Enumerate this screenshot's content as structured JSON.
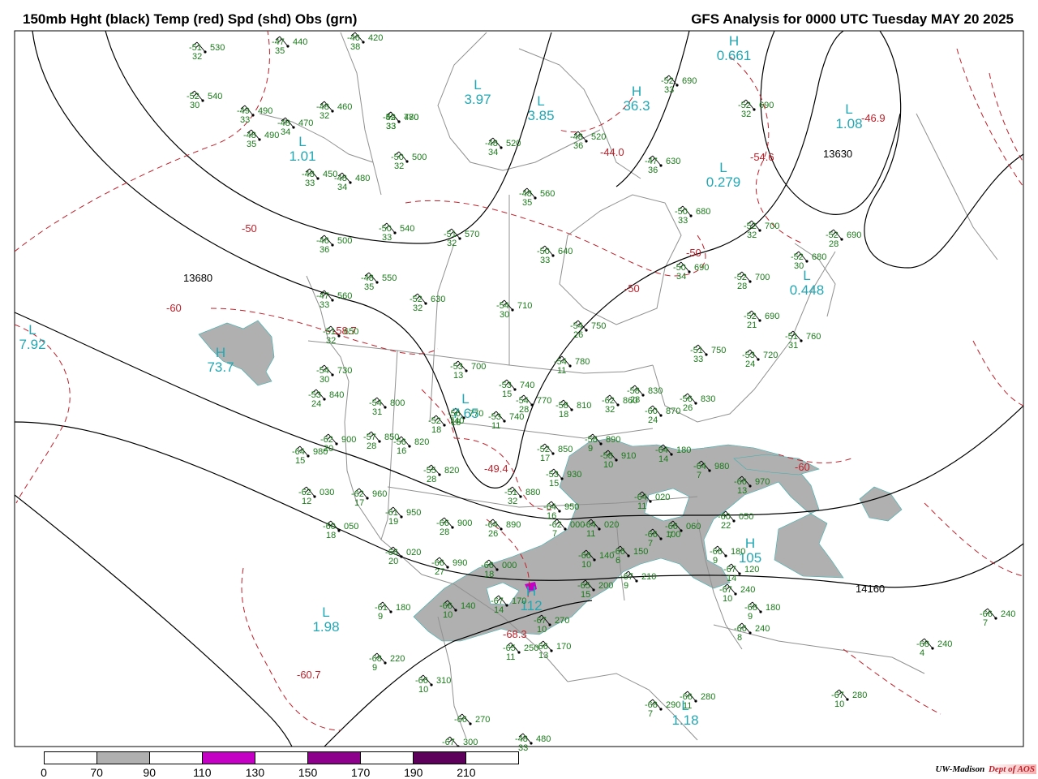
{
  "header": {
    "left_title": "150mb Hght (black) Temp (red) Spd (shd) Obs (grn)",
    "right_title": "GFS Analysis for 0000 UTC Tuesday  MAY 20 2025"
  },
  "colors": {
    "height_contour": "#000000",
    "temperature": "#c0202a",
    "speed_shade": "#b0b0b0",
    "observation": "#1a7a1a",
    "extremum": "#22a7b3",
    "border": "#909090"
  },
  "colorbar": {
    "labels": [
      "0",
      "70",
      "90",
      "110",
      "130",
      "150",
      "170",
      "190",
      "210"
    ],
    "segments": [
      {
        "color": "#ffffff"
      },
      {
        "color": "#b0b0b0"
      },
      {
        "color": "#ffffff"
      },
      {
        "color": "#c400c4"
      },
      {
        "color": "#ffffff"
      },
      {
        "color": "#8c008c"
      },
      {
        "color": "#ffffff"
      },
      {
        "color": "#5c005c"
      },
      {
        "color": "#ffffff"
      }
    ]
  },
  "credit": {
    "org": "UW-Madison",
    "dept": "Dept of AOS"
  },
  "height_labels": [
    "13680",
    "13630",
    "14160"
  ],
  "temperature_labels": [
    "-50",
    "-60",
    "-50",
    "-50",
    "-60",
    "-44.0",
    "-54.6",
    "-49.4",
    "-60.7",
    "-68.3",
    "-46.9",
    "-58.7"
  ],
  "extrema": [
    {
      "label": "L",
      "value": "7.92"
    },
    {
      "label": "H",
      "value": "73.7"
    },
    {
      "label": "L",
      "value": "1.01"
    },
    {
      "label": "L",
      "value": "3.97"
    },
    {
      "label": "L",
      "value": "3.85"
    },
    {
      "label": "H",
      "value": "36.3"
    },
    {
      "label": "L",
      "value": "0.279"
    },
    {
      "label": "L",
      "value": "1.08"
    },
    {
      "label": "H",
      "value": "0.661"
    },
    {
      "label": "L",
      "value": "0.448"
    },
    {
      "label": "L",
      "value": "7.65"
    },
    {
      "label": "H",
      "value": "105"
    },
    {
      "label": "H",
      "value": "112"
    },
    {
      "label": "L",
      "value": "1.98"
    },
    {
      "label": "L",
      "value": "1.18"
    }
  ],
  "observations": [
    {
      "temp": "-51",
      "dew": "32",
      "hgt": "530"
    },
    {
      "temp": "-47",
      "dew": "35",
      "hgt": "440"
    },
    {
      "temp": "-46",
      "dew": "38",
      "hgt": "420"
    },
    {
      "temp": "-52",
      "dew": "30",
      "hgt": "540"
    },
    {
      "temp": "-49",
      "dew": "33",
      "hgt": "490"
    },
    {
      "temp": "-48",
      "dew": "34",
      "hgt": "470"
    },
    {
      "temp": "-48",
      "dew": "32",
      "hgt": "460"
    },
    {
      "temp": "-49",
      "dew": "33",
      "hgt": "480"
    },
    {
      "temp": "-48",
      "dew": "35",
      "hgt": "490"
    },
    {
      "temp": "-48",
      "dew": "34",
      "hgt": "520"
    },
    {
      "temp": "-48",
      "dew": "36",
      "hgt": "520"
    },
    {
      "temp": "-52",
      "dew": "33",
      "hgt": "690"
    },
    {
      "temp": "-52",
      "dew": "32",
      "hgt": "690"
    },
    {
      "temp": "-48",
      "dew": "33",
      "hgt": "450"
    },
    {
      "temp": "-48",
      "dew": "34",
      "hgt": "480"
    },
    {
      "temp": "-50",
      "dew": "32",
      "hgt": "500"
    },
    {
      "temp": "-47",
      "dew": "36",
      "hgt": "630"
    },
    {
      "temp": "-48",
      "dew": "35",
      "hgt": "560"
    },
    {
      "temp": "-50",
      "dew": "33",
      "hgt": "680"
    },
    {
      "temp": "-52",
      "dew": "32",
      "hgt": "700"
    },
    {
      "temp": "-50",
      "dew": "33",
      "hgt": "540"
    },
    {
      "temp": "-51",
      "dew": "32",
      "hgt": "570"
    },
    {
      "temp": "-46",
      "dew": "36",
      "hgt": "500"
    },
    {
      "temp": "-50",
      "dew": "33",
      "hgt": "640"
    },
    {
      "temp": "-50",
      "dew": "34",
      "hgt": "690"
    },
    {
      "temp": "-52",
      "dew": "30",
      "hgt": "680"
    },
    {
      "temp": "-52",
      "dew": "28",
      "hgt": "690"
    },
    {
      "temp": "-52",
      "dew": "28",
      "hgt": "700"
    },
    {
      "temp": "-48",
      "dew": "35",
      "hgt": "550"
    },
    {
      "temp": "-47",
      "dew": "33",
      "hgt": "560"
    },
    {
      "temp": "-52",
      "dew": "32",
      "hgt": "630"
    },
    {
      "temp": "-54",
      "dew": "30",
      "hgt": "710"
    },
    {
      "temp": "-54",
      "dew": "26",
      "hgt": "750"
    },
    {
      "temp": "-52",
      "dew": "21",
      "hgt": "690"
    },
    {
      "temp": "-51",
      "dew": "32",
      "hgt": "650"
    },
    {
      "temp": "-51",
      "dew": "31",
      "hgt": "760"
    },
    {
      "temp": "-51",
      "dew": "33",
      "hgt": "750"
    },
    {
      "temp": "-53",
      "dew": "24",
      "hgt": "720"
    },
    {
      "temp": "-54",
      "dew": "30",
      "hgt": "730"
    },
    {
      "temp": "-53",
      "dew": "13",
      "hgt": "700"
    },
    {
      "temp": "-54",
      "dew": "11",
      "hgt": "780"
    },
    {
      "temp": "-53",
      "dew": "15",
      "hgt": "740"
    },
    {
      "temp": "-54",
      "dew": "28",
      "hgt": "770"
    },
    {
      "temp": "-53",
      "dew": "24",
      "hgt": "840"
    },
    {
      "temp": "-54",
      "dew": "31",
      "hgt": "800"
    },
    {
      "temp": "-53",
      "dew": "11",
      "hgt": "740"
    },
    {
      "temp": "-58",
      "dew": "18",
      "hgt": "810"
    },
    {
      "temp": "-62",
      "dew": "32",
      "hgt": "860"
    },
    {
      "temp": "-58",
      "dew": "28",
      "hgt": "830"
    },
    {
      "temp": "-56",
      "dew": "16",
      "hgt": "820"
    },
    {
      "temp": "-56",
      "dew": "18",
      "hgt": "770"
    },
    {
      "temp": "-60",
      "dew": "24",
      "hgt": "870"
    },
    {
      "temp": "-52",
      "dew": "18",
      "hgt": "740"
    },
    {
      "temp": "-62",
      "dew": "20",
      "hgt": "900"
    },
    {
      "temp": "-57",
      "dew": "28",
      "hgt": "850"
    },
    {
      "temp": "-56",
      "dew": "26",
      "hgt": "830"
    },
    {
      "temp": "-64",
      "dew": "15",
      "hgt": "980"
    },
    {
      "temp": "-55",
      "dew": "28",
      "hgt": "820"
    },
    {
      "temp": "-52",
      "dew": "17",
      "hgt": "850"
    },
    {
      "temp": "-58",
      "dew": "9",
      "hgt": "890"
    },
    {
      "temp": "-58",
      "dew": "10",
      "hgt": "910"
    },
    {
      "temp": "-64",
      "dew": "14",
      "hgt": "180"
    },
    {
      "temp": "-64",
      "dew": "7",
      "hgt": "980"
    },
    {
      "temp": "-66",
      "dew": "13",
      "hgt": "970"
    },
    {
      "temp": "-62",
      "dew": "12",
      "hgt": "030"
    },
    {
      "temp": "-62",
      "dew": "17",
      "hgt": "960"
    },
    {
      "temp": "-51",
      "dew": "32",
      "hgt": "880"
    },
    {
      "temp": "-53",
      "dew": "15",
      "hgt": "930"
    },
    {
      "temp": "-61",
      "dew": "19",
      "hgt": "950"
    },
    {
      "temp": "-64",
      "dew": "16",
      "hgt": "950"
    },
    {
      "temp": "-64",
      "dew": "11",
      "hgt": "020"
    },
    {
      "temp": "-66",
      "dew": "28",
      "hgt": "900"
    },
    {
      "temp": "-64",
      "dew": "26",
      "hgt": "890"
    },
    {
      "temp": "-60",
      "dew": "18",
      "hgt": "050"
    },
    {
      "temp": "-62",
      "dew": "7",
      "hgt": "000"
    },
    {
      "temp": "-64",
      "dew": "11",
      "hgt": "020"
    },
    {
      "temp": "-66",
      "dew": "7",
      "hgt": "100"
    },
    {
      "temp": "-66",
      "dew": "7",
      "hgt": "060"
    },
    {
      "temp": "-60",
      "dew": "22",
      "hgt": "050"
    },
    {
      "temp": "-66",
      "dew": "20",
      "hgt": "020"
    },
    {
      "temp": "-66",
      "dew": "27",
      "hgt": "990"
    },
    {
      "temp": "-66",
      "dew": "18",
      "hgt": "000"
    },
    {
      "temp": "-66",
      "dew": "10",
      "hgt": "140"
    },
    {
      "temp": "-66",
      "dew": "6",
      "hgt": "150"
    },
    {
      "temp": "-66",
      "dew": "9",
      "hgt": "180"
    },
    {
      "temp": "-67",
      "dew": "14",
      "hgt": "120"
    },
    {
      "temp": "-61",
      "dew": "9",
      "hgt": "180"
    },
    {
      "temp": "-66",
      "dew": "10",
      "hgt": "140"
    },
    {
      "temp": "-67",
      "dew": "14",
      "hgt": "170"
    },
    {
      "temp": "-65",
      "dew": "15",
      "hgt": "200"
    },
    {
      "temp": "-67",
      "dew": "9",
      "hgt": "210"
    },
    {
      "temp": "-67",
      "dew": "10",
      "hgt": "240"
    },
    {
      "temp": "-68",
      "dew": "9",
      "hgt": "180"
    },
    {
      "temp": "-67",
      "dew": "10",
      "hgt": "270"
    },
    {
      "temp": "-66",
      "dew": "8",
      "hgt": "240"
    },
    {
      "temp": "-66",
      "dew": "7",
      "hgt": "240"
    },
    {
      "temp": "-68",
      "dew": "4",
      "hgt": "240"
    },
    {
      "temp": "-65",
      "dew": "11",
      "hgt": "250"
    },
    {
      "temp": "-66",
      "dew": "13",
      "hgt": "170"
    },
    {
      "temp": "-68",
      "dew": "9",
      "hgt": "220"
    },
    {
      "temp": "-66",
      "dew": "10",
      "hgt": "310"
    },
    {
      "temp": "-68",
      "dew": "7",
      "hgt": "290"
    },
    {
      "temp": "-66",
      "dew": "11",
      "hgt": "280"
    },
    {
      "temp": "-67",
      "dew": "10",
      "hgt": "280"
    },
    {
      "temp": "-66",
      "dew": "",
      "hgt": "270"
    },
    {
      "temp": "-67",
      "dew": "",
      "hgt": "300"
    },
    {
      "temp": "-48",
      "dew": "33",
      "hgt": "480"
    },
    {
      "temp": "-52",
      "dew": "33",
      "hgt": "770"
    }
  ]
}
